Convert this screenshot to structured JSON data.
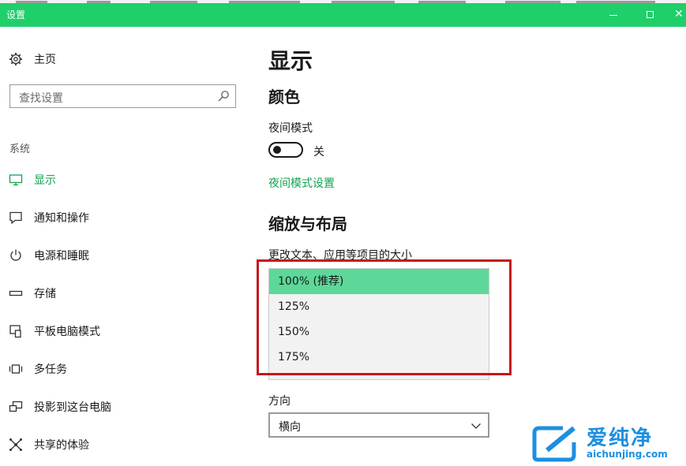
{
  "window": {
    "title": "设置",
    "close_glyph": "✕",
    "accent_color": "#1fcf6a"
  },
  "sidebar": {
    "home_label": "主页",
    "search_placeholder": "查找设置",
    "section_title": "系统",
    "items": [
      {
        "label": "显示",
        "icon": "monitor-icon",
        "active": true
      },
      {
        "label": "通知和操作",
        "icon": "notification-icon",
        "active": false
      },
      {
        "label": "电源和睡眠",
        "icon": "power-icon",
        "active": false
      },
      {
        "label": "存储",
        "icon": "storage-icon",
        "active": false
      },
      {
        "label": "平板电脑模式",
        "icon": "tablet-mode-icon",
        "active": false
      },
      {
        "label": "多任务",
        "icon": "multitasking-icon",
        "active": false
      },
      {
        "label": "投影到这台电脑",
        "icon": "projecting-icon",
        "active": false
      },
      {
        "label": "共享的体验",
        "icon": "shared-experiences-icon",
        "active": false
      }
    ]
  },
  "main": {
    "page_title": "显示",
    "color_heading": "颜色",
    "night_mode_label": "夜间模式",
    "night_mode_state": "关",
    "night_mode_link": "夜间模式设置",
    "scale_heading": "缩放与布局",
    "scale_label": "更改文本、应用等项目的大小",
    "scale_options": [
      "100% (推荐)",
      "125%",
      "150%",
      "175%"
    ],
    "scale_selected_index": 0,
    "orientation_label": "方向",
    "orientation_value": "横向"
  },
  "watermark": {
    "brand": "爱纯净",
    "url": "aichunjing.com"
  }
}
